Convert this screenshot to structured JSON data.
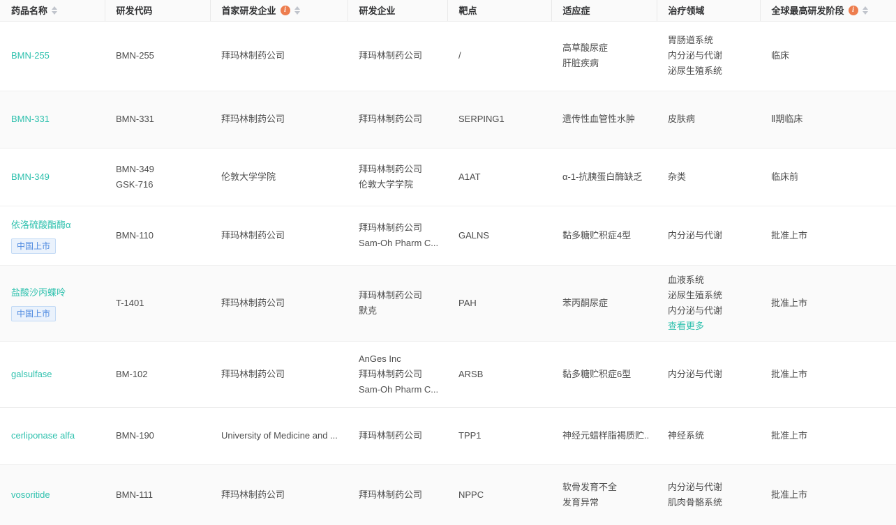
{
  "colors": {
    "accent_link": "#2fc1ae",
    "info_icon": "#ed7d4e",
    "badge_text": "#4e8ae0",
    "badge_bg": "#eaf2fc",
    "badge_border": "#c3daf5",
    "header_bg": "#fafafa",
    "stripe_bg": "#fafafa",
    "row_border": "#eeeeee",
    "body_text": "#4d4d4d",
    "header_text": "#303133"
  },
  "table": {
    "columns": [
      {
        "key": "drug_name",
        "label": "药品名称",
        "sortable": true,
        "info": false
      },
      {
        "key": "rd_code",
        "label": "研发代码",
        "sortable": false,
        "info": false
      },
      {
        "key": "first_developer",
        "label": "首家研发企业",
        "sortable": true,
        "info": true
      },
      {
        "key": "developer",
        "label": "研发企业",
        "sortable": false,
        "info": false
      },
      {
        "key": "target",
        "label": "靶点",
        "sortable": false,
        "info": false
      },
      {
        "key": "indication",
        "label": "适应症",
        "sortable": false,
        "info": false
      },
      {
        "key": "therapy_area",
        "label": "治疗领域",
        "sortable": false,
        "info": false
      },
      {
        "key": "global_highest_phase",
        "label": "全球最高研发阶段",
        "sortable": true,
        "info": true
      }
    ],
    "view_more_label": "查看更多",
    "rows": [
      {
        "drug_name": "BMN-255",
        "badge": null,
        "rd_code": [
          "BMN-255"
        ],
        "first_developer": [
          "拜玛林制药公司"
        ],
        "developer": [
          "拜玛林制药公司"
        ],
        "target": "/",
        "indication": [
          "高草酸尿症",
          "肝脏疾病"
        ],
        "therapy_area": [
          "胃肠道系统",
          "内分泌与代谢",
          "泌尿生殖系统"
        ],
        "has_more": false,
        "global_highest_phase": "临床"
      },
      {
        "drug_name": "BMN-331",
        "badge": null,
        "rd_code": [
          "BMN-331"
        ],
        "first_developer": [
          "拜玛林制药公司"
        ],
        "developer": [
          "拜玛林制药公司"
        ],
        "target": "SERPING1",
        "indication": [
          "遗传性血管性水肿"
        ],
        "therapy_area": [
          "皮肤病"
        ],
        "has_more": false,
        "global_highest_phase": "Ⅱ期临床"
      },
      {
        "drug_name": "BMN-349",
        "badge": null,
        "rd_code": [
          "BMN-349",
          "GSK-716"
        ],
        "first_developer": [
          "伦敦大学学院"
        ],
        "developer": [
          "拜玛林制药公司",
          "伦敦大学学院"
        ],
        "target": "A1AT",
        "indication": [
          "α-1-抗胰蛋白酶缺乏"
        ],
        "therapy_area": [
          "杂类"
        ],
        "has_more": false,
        "global_highest_phase": "临床前"
      },
      {
        "drug_name": "依洛硫酸酯酶α",
        "badge": "中国上市",
        "rd_code": [
          "BMN-110"
        ],
        "first_developer": [
          "拜玛林制药公司"
        ],
        "developer": [
          "拜玛林制药公司",
          "Sam-Oh Pharm C..."
        ],
        "target": "GALNS",
        "indication": [
          "黏多糖贮积症4型"
        ],
        "therapy_area": [
          "内分泌与代谢"
        ],
        "has_more": false,
        "global_highest_phase": "批准上市"
      },
      {
        "drug_name": "盐酸沙丙蝶呤",
        "badge": "中国上市",
        "rd_code": [
          "T-1401"
        ],
        "first_developer": [
          "拜玛林制药公司"
        ],
        "developer": [
          "拜玛林制药公司",
          "默克"
        ],
        "target": "PAH",
        "indication": [
          "苯丙酮尿症"
        ],
        "therapy_area": [
          "血液系统",
          "泌尿生殖系统",
          "内分泌与代谢"
        ],
        "has_more": true,
        "global_highest_phase": "批准上市"
      },
      {
        "drug_name": "galsulfase",
        "badge": null,
        "rd_code": [
          "BM-102"
        ],
        "first_developer": [
          "拜玛林制药公司"
        ],
        "developer": [
          "AnGes Inc",
          "拜玛林制药公司",
          "Sam-Oh Pharm C..."
        ],
        "target": "ARSB",
        "indication": [
          "黏多糖贮积症6型"
        ],
        "therapy_area": [
          "内分泌与代谢"
        ],
        "has_more": false,
        "global_highest_phase": "批准上市"
      },
      {
        "drug_name": "cerliponase alfa",
        "badge": null,
        "rd_code": [
          "BMN-190"
        ],
        "first_developer": [
          "University of Medicine and ..."
        ],
        "developer": [
          "拜玛林制药公司"
        ],
        "target": "TPP1",
        "indication": [
          "神经元蜡样脂褐质贮..."
        ],
        "therapy_area": [
          "神经系统"
        ],
        "has_more": false,
        "global_highest_phase": "批准上市"
      },
      {
        "drug_name": "vosoritide",
        "badge": null,
        "rd_code": [
          "BMN-111"
        ],
        "first_developer": [
          "拜玛林制药公司"
        ],
        "developer": [
          "拜玛林制药公司"
        ],
        "target": "NPPC",
        "indication": [
          "软骨发育不全",
          "发育异常"
        ],
        "therapy_area": [
          "内分泌与代谢",
          "肌肉骨骼系统"
        ],
        "has_more": false,
        "global_highest_phase": "批准上市"
      }
    ]
  }
}
